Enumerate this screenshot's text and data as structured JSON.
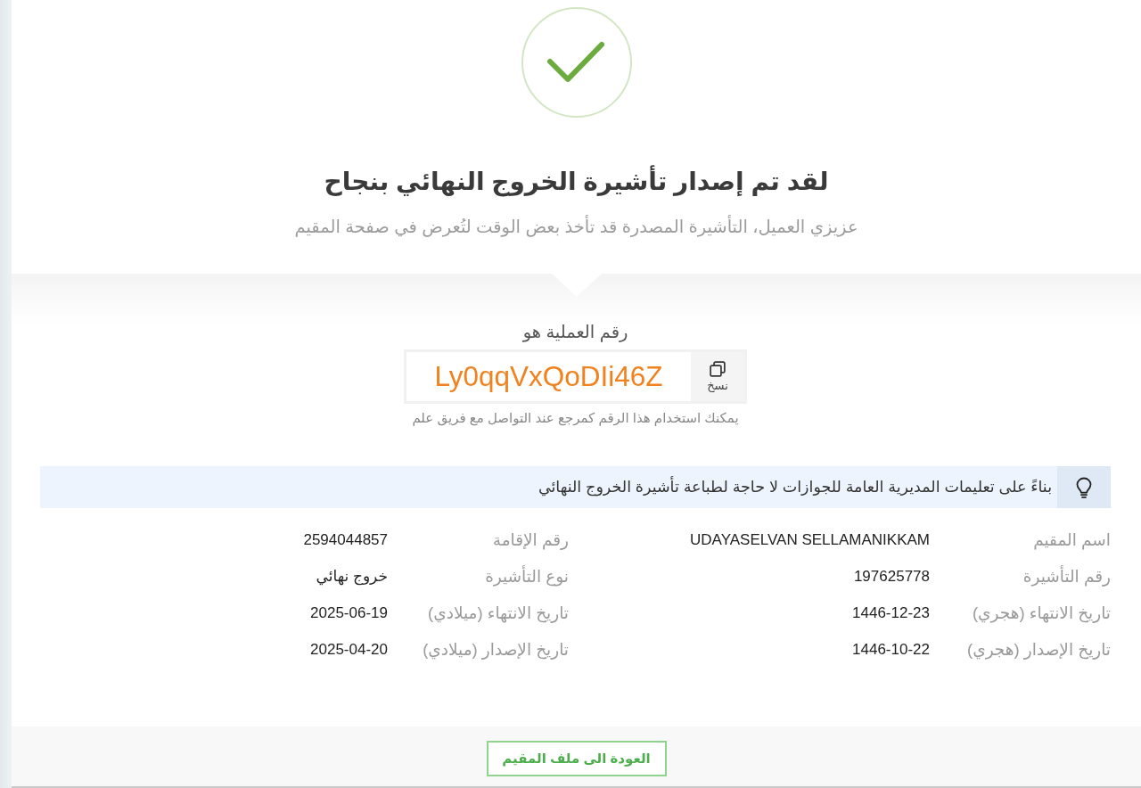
{
  "title": "لقد تم إصدار تأشيرة الخروج النهائي بنجاح",
  "subtitle": "عزيزي العميل، التأشيرة المصدرة قد تأخذ بعض الوقت لتُعرض في صفحة المقيم",
  "reference": {
    "label": "رقم العملية هو",
    "code": "Ly0qqVxQoDIi46Z",
    "copy_button": "نسخ",
    "hint": "يمكنك استخدام هذا الرقم كمرجع عند التواصل مع فريق علم"
  },
  "notice": "بناءً على تعليمات المديرية العامة للجوازات لا حاجة لطباعة تأشيرة الخروج النهائي",
  "details": [
    {
      "label": "اسم المقيم",
      "value": "UDAYASELVAN SELLAMANIKKAM"
    },
    {
      "label": "رقم الإقامة",
      "value": "2594044857"
    },
    {
      "label": "رقم التأشيرة",
      "value": "197625778"
    },
    {
      "label": "نوع التأشيرة",
      "value": "خروج نهائي"
    },
    {
      "label": "تاريخ الانتهاء (هجري)",
      "value": "1446-12-23"
    },
    {
      "label": "تاريخ الانتهاء (ميلادي)",
      "value": "2025-06-19"
    },
    {
      "label": "تاريخ الإصدار (هجري)",
      "value": "1446-10-22"
    },
    {
      "label": "تاريخ الإصدار (ميلادي)",
      "value": "2025-04-20"
    }
  ],
  "back_button": "العودة الى ملف المقيم"
}
